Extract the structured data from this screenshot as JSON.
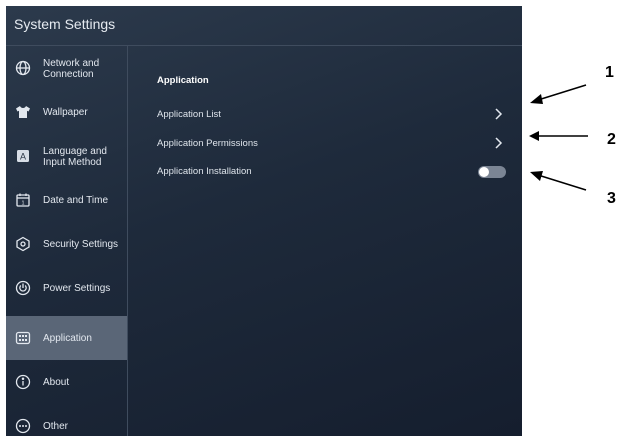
{
  "window": {
    "title": "System Settings"
  },
  "sidebar": {
    "items": [
      {
        "label": "Network and\nConnection",
        "icon": "globe-icon"
      },
      {
        "label": "Wallpaper",
        "icon": "shirt-icon"
      },
      {
        "label": "Language and\nInput Method",
        "icon": "keyboard-a-icon"
      },
      {
        "label": "Date and Time",
        "icon": "calendar-icon"
      },
      {
        "label": "Security Settings",
        "icon": "shield-hexagon-icon"
      },
      {
        "label": "Power Settings",
        "icon": "power-icon"
      },
      {
        "label": "Application",
        "icon": "apps-grid-icon",
        "selected": true
      },
      {
        "label": "About",
        "icon": "info-icon"
      },
      {
        "label": "Other",
        "icon": "more-dots-icon"
      }
    ]
  },
  "main": {
    "section_title": "Application",
    "rows": [
      {
        "label": "Application List",
        "control": "chevron-right-icon"
      },
      {
        "label": "Application Permissions",
        "control": "chevron-right-icon"
      },
      {
        "label": "Application Installation",
        "control": "toggle",
        "enabled": false
      }
    ]
  },
  "callouts": [
    "1",
    "2",
    "3"
  ],
  "colors": {
    "background": "#1e2a3b",
    "selected_item": "#5a6677",
    "text": "#e3e8ef"
  }
}
